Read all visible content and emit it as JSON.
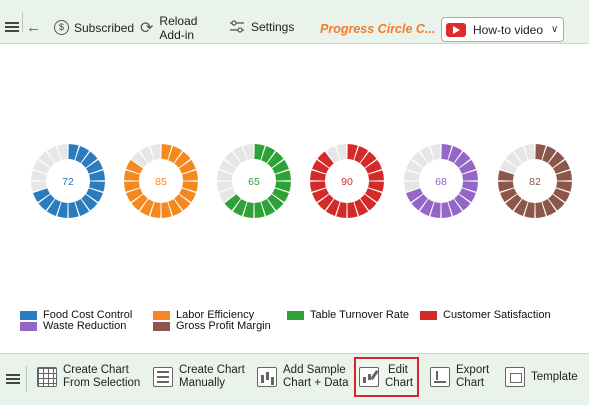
{
  "toolbar": {
    "subscribed_label": "Subscribed",
    "reload_line1": "Reload",
    "reload_line2": "Add-in",
    "settings_label": "Settings",
    "title": "Progress Circle C...",
    "howto_label": "How-to video"
  },
  "chart_data": {
    "type": "progress-circles",
    "segments_per_ring": 20,
    "track_color": "#e6e6e6",
    "items": [
      {
        "name": "Food Cost Control",
        "value": 72,
        "color": "#2b7bbf"
      },
      {
        "name": "Labor Efficiency",
        "value": 85,
        "color": "#f5891f"
      },
      {
        "name": "Table Turnover Rate",
        "value": 65,
        "color": "#2ea236"
      },
      {
        "name": "Customer Satisfaction",
        "value": 90,
        "color": "#d42a2a"
      },
      {
        "name": "Waste Reduction",
        "value": 68,
        "color": "#9466c5"
      },
      {
        "name": "Gross Profit Margin",
        "value": 82,
        "color": "#8c564b"
      }
    ]
  },
  "bottombar": {
    "create_from_selection_1": "Create Chart",
    "create_from_selection_2": "From Selection",
    "create_manually_1": "Create Chart",
    "create_manually_2": "Manually",
    "add_sample_1": "Add Sample",
    "add_sample_2": "Chart + Data",
    "edit_1": "Edit",
    "edit_2": "Chart",
    "export_1": "Export",
    "export_2": "Chart",
    "template": "Template"
  }
}
